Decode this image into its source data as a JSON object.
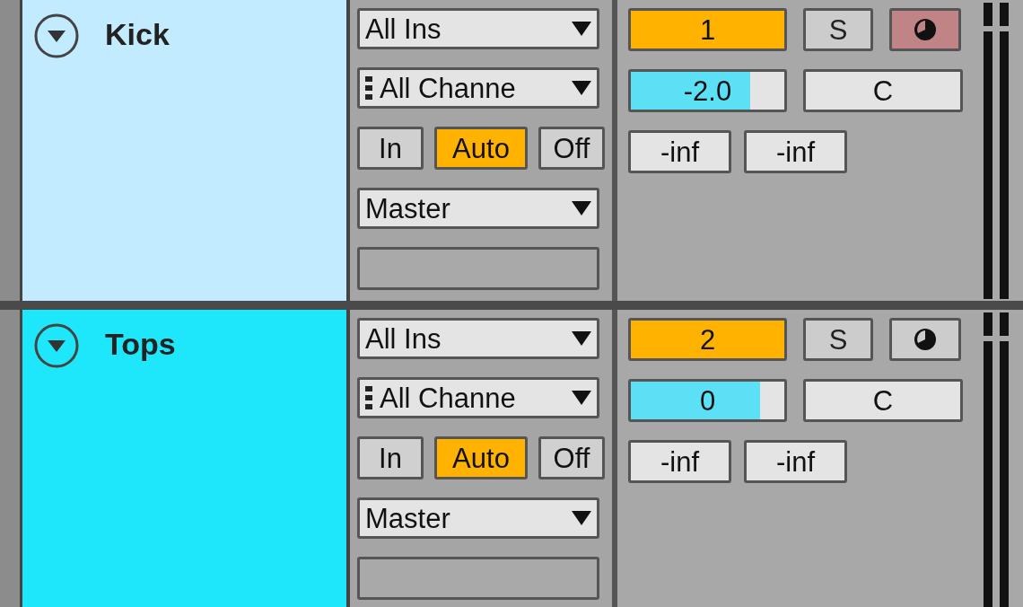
{
  "tracks": [
    {
      "name": "Kick",
      "color": "#c2ebff",
      "input_type": "All Ins",
      "input_channel": "All Channe",
      "monitor": [
        {
          "label": "In",
          "selected": false
        },
        {
          "label": "Auto",
          "selected": true
        },
        {
          "label": "Off",
          "selected": false
        }
      ],
      "output": "Master",
      "number": "1",
      "solo": "S",
      "arm": true,
      "volume": {
        "reading": "-2.0",
        "level": 0.78
      },
      "pan": "C",
      "peaks": [
        "-inf",
        "-inf"
      ]
    },
    {
      "name": "Tops",
      "color": "#1ee6fb",
      "input_type": "All Ins",
      "input_channel": "All Channe",
      "monitor": [
        {
          "label": "In",
          "selected": false
        },
        {
          "label": "Auto",
          "selected": true
        },
        {
          "label": "Off",
          "selected": false
        }
      ],
      "output": "Master",
      "number": "2",
      "solo": "S",
      "arm": false,
      "volume": {
        "reading": "0",
        "level": 0.84
      },
      "pan": "C",
      "peaks": [
        "-inf",
        "-inf"
      ]
    }
  ]
}
